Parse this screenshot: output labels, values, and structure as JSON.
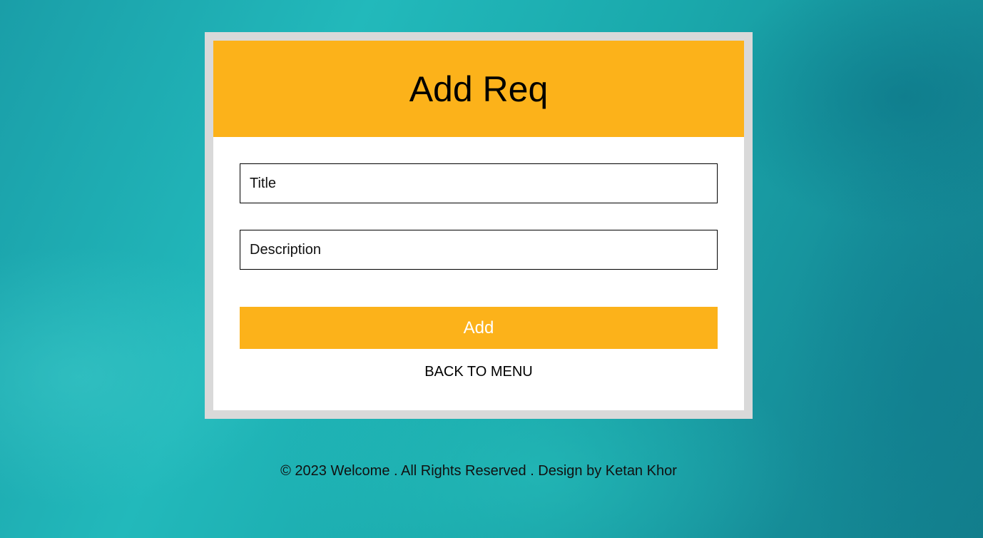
{
  "form": {
    "heading": "Add Req",
    "title_placeholder": "Title",
    "description_placeholder": "Description",
    "add_label": "Add",
    "back_label": "BACK TO MENU"
  },
  "footer": {
    "text": "© 2023 Welcome . All Rights Reserved . Design by Ketan Khor"
  },
  "colors": {
    "accent": "#fcb21a",
    "frame": "#d9d9d9",
    "background": "#1aa9ac"
  }
}
